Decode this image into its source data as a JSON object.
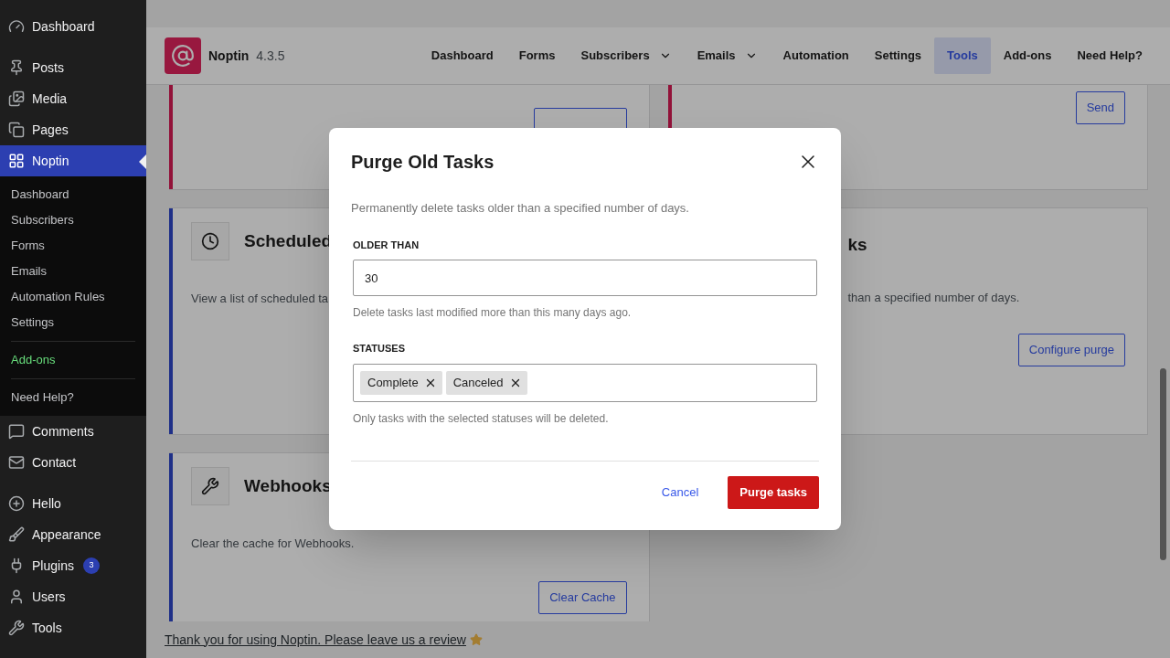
{
  "sidebar": {
    "groups": [
      {
        "items": [
          {
            "label": "Dashboard",
            "selected": false
          }
        ]
      },
      {
        "items": [
          {
            "label": "Posts",
            "selected": false
          },
          {
            "label": "Media",
            "selected": false
          },
          {
            "label": "Pages",
            "selected": false
          },
          {
            "label": "Noptin",
            "selected": true,
            "submenu": [
              [
                {
                  "label": "Dashboard",
                  "highlighted": false
                },
                {
                  "label": "Subscribers",
                  "highlighted": false
                },
                {
                  "label": "Forms",
                  "highlighted": false
                },
                {
                  "label": "Emails",
                  "highlighted": false
                },
                {
                  "label": "Automation Rules",
                  "highlighted": false
                },
                {
                  "label": "Settings",
                  "highlighted": false
                }
              ],
              [
                {
                  "label": "Add-ons",
                  "highlighted": true
                }
              ],
              [
                {
                  "label": "Need Help?",
                  "highlighted": false
                }
              ]
            ]
          },
          {
            "label": "Comments",
            "selected": false
          },
          {
            "label": "Contact",
            "selected": false
          }
        ]
      },
      {
        "items": [
          {
            "label": "Hello",
            "selected": false
          },
          {
            "label": "Appearance",
            "selected": false
          },
          {
            "label": "Plugins",
            "selected": false,
            "badge": "3"
          },
          {
            "label": "Users",
            "selected": false
          },
          {
            "label": "Tools",
            "selected": false
          }
        ]
      }
    ]
  },
  "header": {
    "app_name": "Noptin",
    "version": "4.3.5",
    "nav": [
      {
        "label": "Dashboard",
        "selected": false,
        "kind": "link"
      },
      {
        "label": "Forms",
        "selected": false,
        "kind": "link"
      },
      {
        "label": "Subscribers",
        "selected": false,
        "kind": "menu"
      },
      {
        "label": "Emails",
        "selected": false,
        "kind": "menu"
      },
      {
        "label": "Automation",
        "selected": false,
        "kind": "link"
      },
      {
        "label": "Settings",
        "selected": false,
        "kind": "link"
      },
      {
        "label": "Tools",
        "selected": true,
        "kind": "link"
      },
      {
        "label": "Add-ons",
        "selected": false,
        "kind": "link"
      },
      {
        "label": "Need Help?",
        "selected": false,
        "kind": "link"
      }
    ]
  },
  "cards": [
    {
      "kind": "top"
    },
    {
      "kind": "top",
      "button": "Send"
    },
    {
      "kind": "tool",
      "title": "Scheduled",
      "description": "View a list of scheduled ta"
    },
    {
      "kind": "tool_partial",
      "title": "ks",
      "description": "than a specified number of days.",
      "button": "Configure purge"
    },
    {
      "kind": "tool",
      "title": "Webhooks",
      "description": "Clear the cache for Webhooks.",
      "button": "Clear Cache"
    }
  ],
  "footer": {
    "text": "Thank you for using Noptin. Please leave us a review"
  },
  "modal": {
    "title": "Purge Old Tasks",
    "description": "Permanently delete tasks older than a specified number of days.",
    "fields": [
      {
        "kind": "number",
        "label": "OLDER THAN",
        "value": "30",
        "help": "Delete tasks last modified more than this many days ago."
      },
      {
        "kind": "tags",
        "label": "STATUSES",
        "tags": [
          "Complete",
          "Canceled"
        ],
        "help": "Only tasks with the selected statuses will be deleted."
      }
    ],
    "cancel": "Cancel",
    "confirm": "Purge tasks"
  }
}
